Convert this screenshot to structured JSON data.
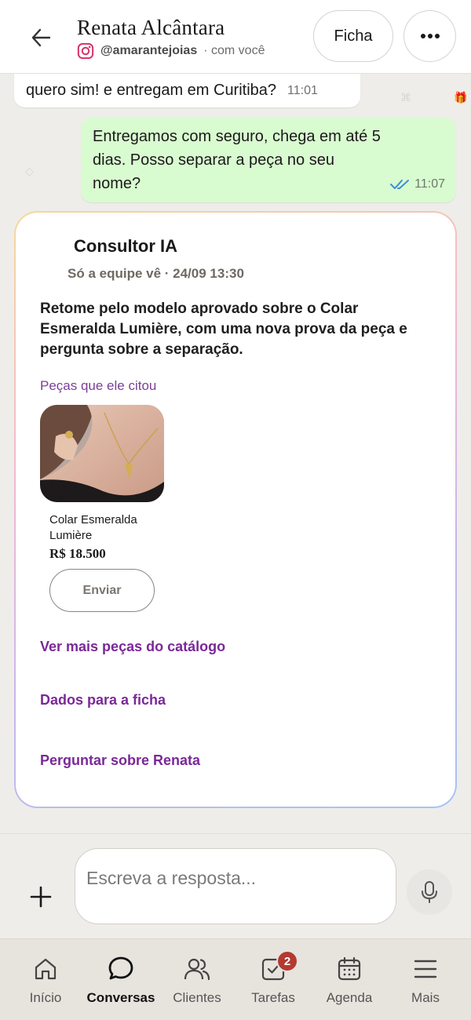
{
  "header": {
    "contact_name": "Renata Alcântara",
    "instagram_handle": "@amarantejoias",
    "with_you": "· com você",
    "ficha_label": "Ficha",
    "icons": {
      "back": "arrow-left-icon",
      "instagram": "instagram-icon",
      "more": "more-horizontal-icon"
    }
  },
  "messages": [
    {
      "direction": "incoming",
      "text": "quero sim! e entregam em Curitiba?",
      "time": "11:01"
    },
    {
      "direction": "outgoing",
      "text": "Entregamos com seguro, chega em até 5 dias. Posso separar a peça no seu nome?",
      "time": "11:07",
      "status": "read"
    }
  ],
  "ai_card": {
    "title": "Consultor IA",
    "meta": "Só a equipe vê · 24/09 13:30",
    "body": "Retome pelo modelo aprovado sobre o Colar Esmeralda Lumière, com uma nova prova da peça e pergunta sobre a separação.",
    "section_label": "Peças que ele citou",
    "product": {
      "name": "Colar Esmeralda Lumière",
      "price": "R$ 18.500",
      "send_label": "Enviar"
    },
    "links": [
      "Ver mais peças do catálogo",
      "Dados para a ficha",
      "Perguntar sobre Renata"
    ]
  },
  "composer": {
    "placeholder": "Escreva a resposta...",
    "icons": {
      "add": "plus-icon",
      "mic": "microphone-icon"
    }
  },
  "nav": {
    "items": [
      {
        "label": "Início",
        "icon": "home-icon",
        "active": false
      },
      {
        "label": "Conversas",
        "icon": "chat-bubble-icon",
        "active": true
      },
      {
        "label": "Clientes",
        "icon": "users-icon",
        "active": false
      },
      {
        "label": "Tarefas",
        "icon": "tasks-icon",
        "active": false,
        "badge": "2"
      },
      {
        "label": "Agenda",
        "icon": "calendar-icon",
        "active": false
      },
      {
        "label": "Mais",
        "icon": "menu-icon",
        "active": false
      }
    ]
  },
  "colors": {
    "outgoing_bubble": "#d9fbd0",
    "link_purple": "#7a2898",
    "badge_red": "#b33a32",
    "read_ticks": "#3b8fd6"
  }
}
